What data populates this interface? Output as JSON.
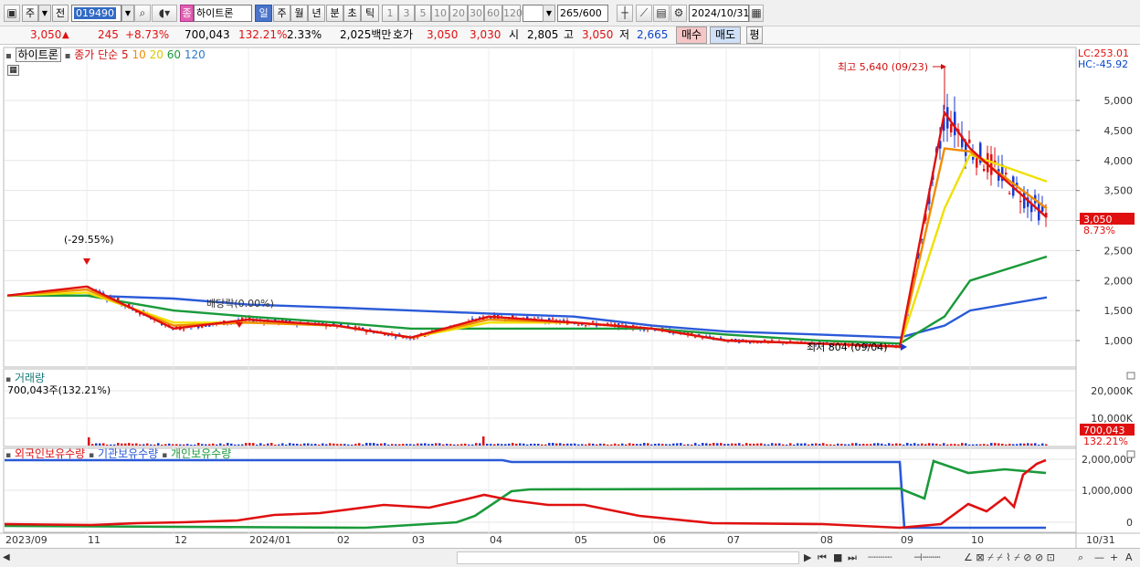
{
  "toolbar": {
    "period_select": "주",
    "prev_label": "전",
    "stock_code": "019490",
    "stock_badge": "종",
    "stock_name": "하이트론",
    "tabs": [
      "일",
      "주",
      "월",
      "년",
      "분",
      "초",
      "틱"
    ],
    "active_tab": "일",
    "intervals": [
      "1",
      "3",
      "5",
      "10",
      "20",
      "30",
      "60",
      "120"
    ],
    "count_current": "265",
    "count_total": "/600",
    "date": "2024/10/31"
  },
  "quote": {
    "price": "3,050",
    "change_arrow": "▲",
    "change": "245",
    "change_pct": "+8.73%",
    "volume": "700,043",
    "volume_ratio": "132.21%",
    "turnover": "2.33%",
    "amount": "2,025백만",
    "bid_label": "호가",
    "ask_price": "3,050",
    "bid_price": "3,030",
    "open_label": "시",
    "open": "2,805",
    "high_label": "고",
    "high": "3,050",
    "low_label": "저",
    "low": "2,665",
    "buy_label": "매수",
    "sell_label": "매도",
    "avg_label": "평"
  },
  "price_panel": {
    "legend_name": "하이트론",
    "legend_ma": "종가 단순",
    "ma_periods": [
      "5",
      "10",
      "20",
      "60",
      "120"
    ],
    "lc": "LC:253.01",
    "hc": "HC:-45.92",
    "y_ticks": [
      "5,000",
      "4,500",
      "4,000",
      "3,500",
      "3,000",
      "2,500",
      "2,000",
      "1,500",
      "1,000"
    ],
    "high_annotation": "최고 5,640 (09/23)",
    "low_annotation": "최저 804 (09/04)",
    "drop_annotation": "(-29.55%)",
    "dividend_annotation": "배당락(0.00%)",
    "price_tag": "3,050",
    "pct_tag": "8.73%"
  },
  "volume_panel": {
    "title": "거래량",
    "subtitle": "700,043주(132.21%)",
    "y_ticks": [
      "20,000K",
      "10,000K"
    ],
    "value_tag": "700,043",
    "pct_tag": "132.21%"
  },
  "holdings_panel": {
    "legend": [
      "외국인보유수량",
      "기관보유수량",
      "개인보유수량"
    ],
    "y_ticks": [
      "2,000,000",
      "1,000,000",
      "0"
    ]
  },
  "x_axis": [
    "2023/09",
    "11",
    "12",
    "2024/01",
    "02",
    "03",
    "04",
    "05",
    "06",
    "07",
    "08",
    "09",
    "10",
    "10/31"
  ],
  "colors": {
    "ma5": "#e01010",
    "ma10": "#f08c00",
    "ma20": "#f0e000",
    "ma60": "#1a9a3a",
    "ma120": "#2a5ad8",
    "foreign": "#e01010",
    "institution": "#1a9a3a",
    "individual": "#2a5ad8"
  },
  "chart_data": [
    {
      "type": "line",
      "title": "",
      "x": [
        "2023/09",
        "2023/11",
        "2023/12",
        "2024/01",
        "2024/02",
        "2024/03",
        "2024/04",
        "2024/05",
        "2024/06",
        "2024/07",
        "2024/08",
        "2024/09",
        "2024/09/23",
        "2024/10",
        "2024/10/31"
      ],
      "series": [
        {
          "name": "5",
          "values": [
            1750,
            1900,
            1200,
            1350,
            1250,
            1050,
            1400,
            1300,
            1200,
            1000,
            950,
            900,
            4800,
            4200,
            3050
          ]
        },
        {
          "name": "10",
          "values": [
            1750,
            1850,
            1250,
            1300,
            1250,
            1050,
            1350,
            1300,
            1200,
            1000,
            950,
            900,
            4200,
            4150,
            3200
          ]
        },
        {
          "name": "20",
          "values": [
            1750,
            1800,
            1300,
            1300,
            1250,
            1050,
            1300,
            1300,
            1200,
            1000,
            950,
            900,
            3200,
            4100,
            3650
          ]
        },
        {
          "name": "60",
          "values": [
            1750,
            1750,
            1500,
            1400,
            1300,
            1200,
            1200,
            1200,
            1200,
            1100,
            1000,
            950,
            1400,
            2000,
            2400
          ]
        },
        {
          "name": "120",
          "values": [
            1750,
            1750,
            1700,
            1600,
            1550,
            1500,
            1450,
            1400,
            1250,
            1150,
            1100,
            1050,
            1250,
            1500,
            1720
          ]
        }
      ],
      "ylim": [
        750,
        5500
      ]
    }
  ]
}
